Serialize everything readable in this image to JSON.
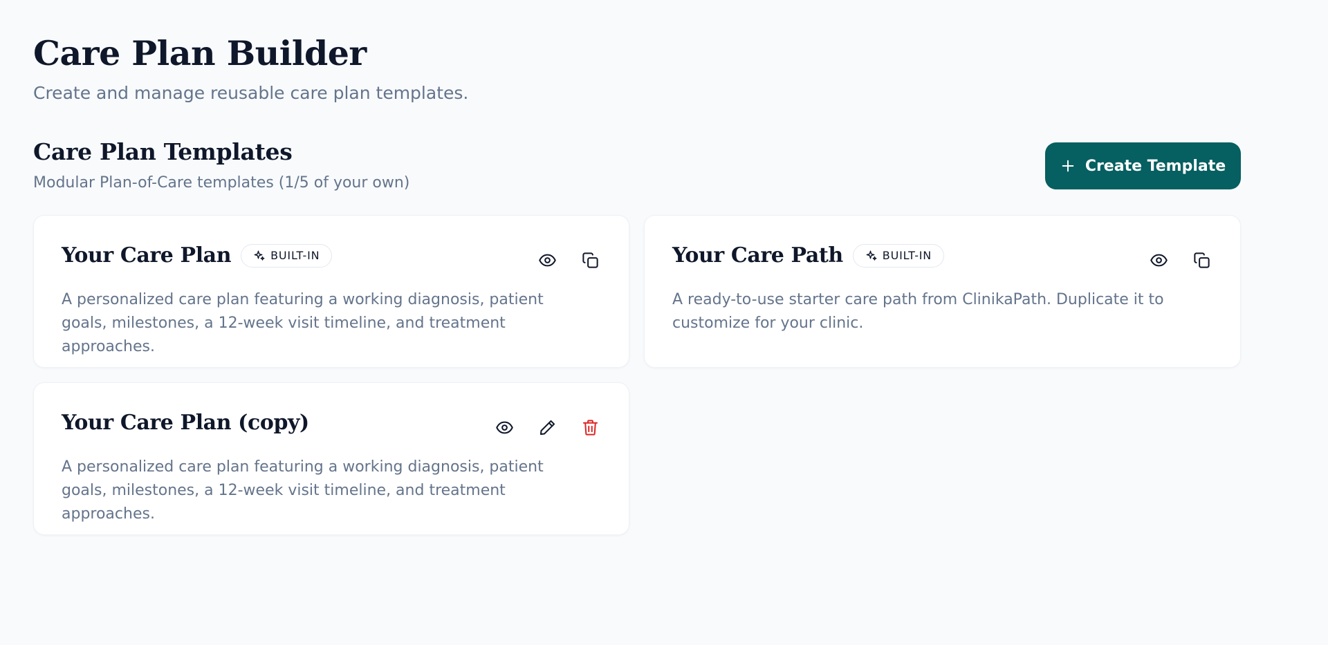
{
  "header": {
    "title": "Care Plan Builder",
    "subtitle": "Create and manage reusable care plan templates."
  },
  "section": {
    "title": "Care Plan Templates",
    "subtitle": "Modular Plan-of-Care templates (1/5 of your own)",
    "create_button_label": "Create Template",
    "create_button_icon": "plus-icon"
  },
  "colors": {
    "accent": "#065f60",
    "danger": "#dc2626",
    "muted_text": "#64748b",
    "heading_text": "#0f172a",
    "background": "#f8fafc"
  },
  "templates": [
    {
      "title": "Your Care Plan",
      "badge": "BUILT-IN",
      "badge_icon": "sparkle-icon",
      "description": "A personalized care plan featuring a working diagnosis, patient goals, milestones, a 12-week visit timeline, and treatment approaches.",
      "actions": [
        "view",
        "duplicate"
      ]
    },
    {
      "title": "Your Care Path",
      "badge": "BUILT-IN",
      "badge_icon": "sparkle-icon",
      "description": "A ready-to-use starter care path from ClinikaPath. Duplicate it to customize for your clinic.",
      "actions": [
        "view",
        "duplicate"
      ]
    },
    {
      "title": "Your Care Plan (copy)",
      "description": "A personalized care plan featuring a working diagnosis, patient goals, milestones, a 12-week visit timeline, and treatment approaches.",
      "actions": [
        "view",
        "edit",
        "delete"
      ]
    }
  ]
}
